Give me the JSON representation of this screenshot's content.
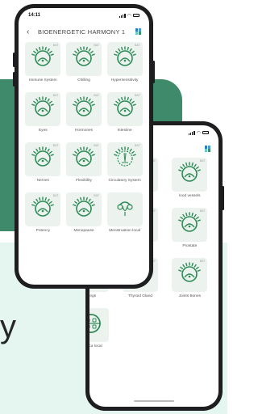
{
  "background_text": "y",
  "colors": {
    "accent": "#3f8a6b",
    "mint": "#e4f6ef",
    "icon_green": "#2e8b57"
  },
  "front": {
    "time": "14:11",
    "title": "BIOENERGETIC HARMONY 1",
    "items": [
      {
        "label": "Immune System",
        "badge": "BAT",
        "icon": "dial-icon"
      },
      {
        "label": "Chilling",
        "badge": "BAT",
        "icon": "dial-icon"
      },
      {
        "label": "Hypersensitivity",
        "badge": "BAT",
        "icon": "dial-icon"
      },
      {
        "label": "Eyes",
        "badge": "BAT",
        "icon": "dial-icon"
      },
      {
        "label": "Hormones",
        "badge": "BAT",
        "icon": "dial-icon"
      },
      {
        "label": "Intestine",
        "badge": "BAT",
        "icon": "dial-icon"
      },
      {
        "label": "Nerves",
        "badge": "BAT",
        "icon": "dial-icon"
      },
      {
        "label": "Flexibility",
        "badge": "BAT",
        "icon": "dial-icon"
      },
      {
        "label": "Circulatory System",
        "badge": "BAT",
        "icon": "circulatory-icon"
      },
      {
        "label": "Potency",
        "badge": "BAT",
        "icon": "dial-icon"
      },
      {
        "label": "Menopause",
        "badge": "BAT",
        "icon": "dial-icon"
      },
      {
        "label": "Menstruation local",
        "badge": "",
        "icon": "uterus-icon"
      }
    ]
  },
  "back": {
    "title": "C HARMONY 2",
    "items": [
      {
        "label": "acteria",
        "badge": "BAT",
        "icon": "dial-icon"
      },
      {
        "label": "Tonsils",
        "badge": "BAT",
        "icon": "dial-icon"
      },
      {
        "label": "lood vessels",
        "badge": "BAT",
        "icon": "dial-icon"
      },
      {
        "label": "Toxins",
        "badge": "BAT",
        "icon": "dial-icon"
      },
      {
        "label": "Head",
        "badge": "BAT",
        "icon": "head-icon"
      },
      {
        "label": "Prostate",
        "badge": "BAT",
        "icon": "dial-icon"
      },
      {
        "label": "Lungs",
        "badge": "",
        "icon": "lungs-icon"
      },
      {
        "label": "Thyroid Gland",
        "badge": "BAT",
        "icon": "dial-icon"
      },
      {
        "label": "Joints Bones",
        "badge": "BAT",
        "icon": "dial-icon"
      },
      {
        "label": "Sciatica local",
        "badge": "",
        "icon": "spine-icon"
      }
    ]
  }
}
